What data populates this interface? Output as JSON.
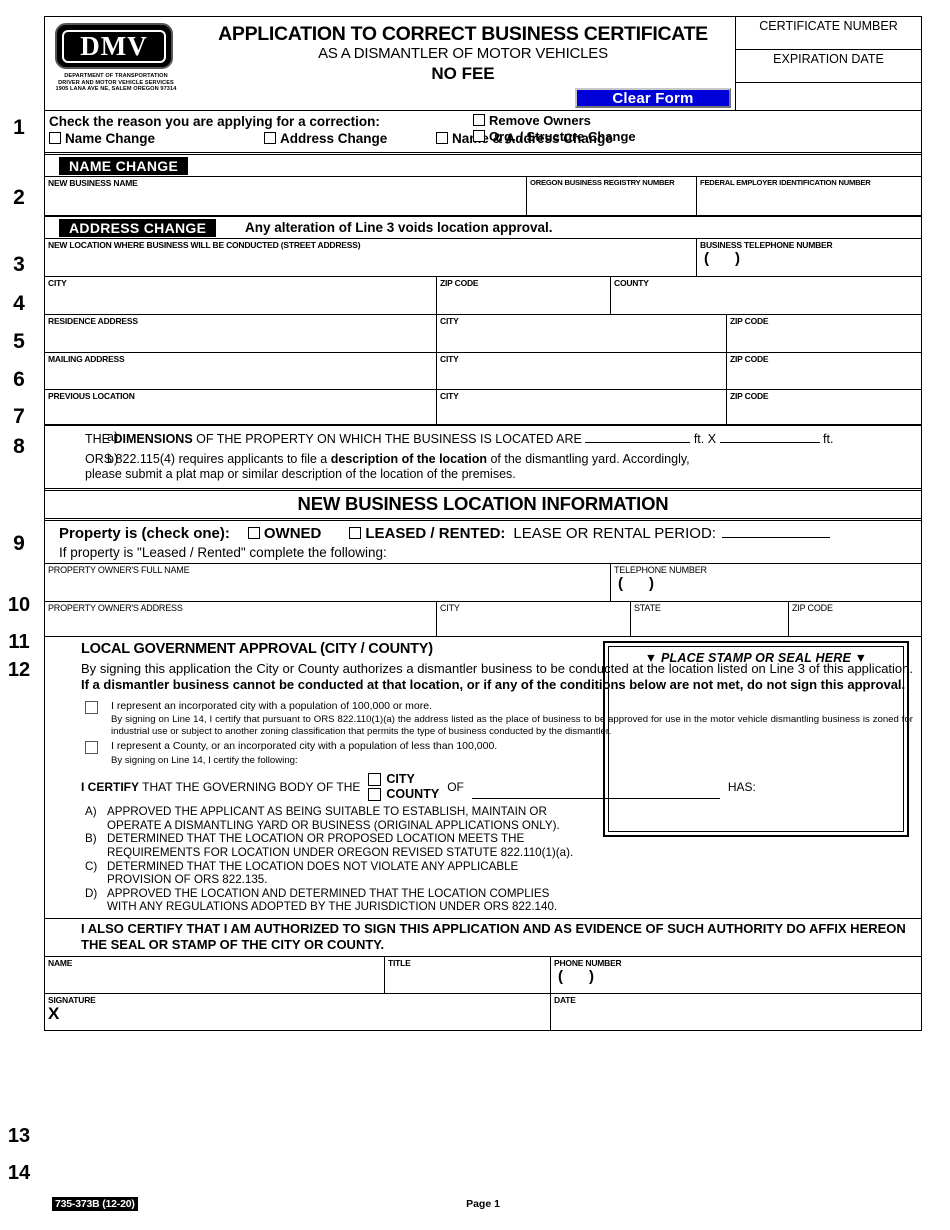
{
  "header": {
    "logo_word": "DMV",
    "agency_lines": [
      "DEPARTMENT OF TRANSPORTATION",
      "DRIVER AND MOTOR VEHICLE SERVICES",
      "1905 LANA AVE NE, SALEM OREGON 97314"
    ],
    "title": "APPLICATION TO CORRECT BUSINESS CERTIFICATE",
    "subtitle": "AS A DISMANTLER OF MOTOR VEHICLES",
    "fee": "NO FEE",
    "clear_form_label": "Clear Form",
    "clear_form_bg": "#0000d8",
    "certificate_number_label": "CERTIFICATE NUMBER",
    "expiration_date_label": "EXPIRATION DATE"
  },
  "section1": {
    "number": "1",
    "heading": "Check the reason you are applying for a correction:",
    "options": [
      {
        "label": "Name Change"
      },
      {
        "label": "Address Change"
      },
      {
        "label": "Name & Address Change"
      }
    ],
    "right_options": [
      {
        "label": "Remove Owners"
      },
      {
        "label": "Org. / Structure Change"
      }
    ]
  },
  "name_change": {
    "tag": "NAME CHANGE",
    "number": "2",
    "fields": [
      {
        "label": "NEW BUSINESS NAME"
      },
      {
        "label": "OREGON BUSINESS REGISTRY NUMBER"
      },
      {
        "label": "FEDERAL EMPLOYER IDENTIFICATION NUMBER"
      }
    ]
  },
  "address_change": {
    "tag": "ADDRESS CHANGE",
    "note": "Any alteration of Line 3 voids location approval.",
    "rows": [
      {
        "number": "3",
        "cells": [
          {
            "label": "NEW LOCATION WHERE BUSINESS WILL BE CONDUCTED    (STREET ADDRESS)"
          },
          {
            "label": "BUSINESS TELEPHONE NUMBER",
            "phone": true
          }
        ]
      },
      {
        "number": "4",
        "cells": [
          {
            "label": "CITY"
          },
          {
            "label": "ZIP CODE"
          },
          {
            "label": "COUNTY"
          }
        ]
      },
      {
        "number": "5",
        "cells": [
          {
            "label": "RESIDENCE ADDRESS"
          },
          {
            "label": "CITY"
          },
          {
            "label": "ZIP CODE"
          }
        ]
      },
      {
        "number": "6",
        "cells": [
          {
            "label": "MAILING ADDRESS"
          },
          {
            "label": "CITY"
          },
          {
            "label": "ZIP CODE"
          }
        ]
      },
      {
        "number": "7",
        "cells": [
          {
            "label": "PREVIOUS LOCATION"
          },
          {
            "label": "CITY"
          },
          {
            "label": "ZIP CODE"
          }
        ]
      }
    ]
  },
  "section8": {
    "number": "8",
    "a_marker": "a)",
    "a_pre": "THE ",
    "a_bold": "DIMENSIONS",
    "a_mid": " OF THE PROPERTY ON WHICH THE BUSINESS IS LOCATED ARE ",
    "a_ft1": "ft. X",
    "a_ft2": "ft.",
    "b_marker": "b)",
    "b_pre": "ORS 822.115(4) requires applicants to file a ",
    "b_bold": "description of the location",
    "b_post": " of the dismantling yard. Accordingly,",
    "b_line2": "please submit a plat map or similar description of the location of the premises."
  },
  "new_location_banner": "NEW BUSINESS LOCATION INFORMATION",
  "section9": {
    "number": "9",
    "prompt": "Property is (check one):",
    "owned_label": "OWNED",
    "leased_label": "LEASED / RENTED:",
    "lease_period_label": "LEASE OR RENTAL PERIOD:",
    "note": "If property is \"Leased / Rented\" complete the following:"
  },
  "owner_rows": [
    {
      "number": "10",
      "cells": [
        {
          "label": "PROPERTY OWNER'S FULL NAME"
        },
        {
          "label": "TELEPHONE NUMBER",
          "phone": true
        }
      ]
    },
    {
      "number": "11",
      "cells": [
        {
          "label": "PROPERTY OWNER'S ADDRESS"
        },
        {
          "label": "CITY"
        },
        {
          "label": "STATE"
        },
        {
          "label": "ZIP CODE"
        }
      ]
    }
  ],
  "section12": {
    "number": "12",
    "heading": "LOCAL GOVERNMENT APPROVAL (CITY / COUNTY)",
    "para_normal1": "By signing this application the City or County authorizes a dismantler business to be conducted at the location listed on Line 3 of this application. ",
    "para_bold": "If a dismantler business cannot be conducted at that location, or if any of the conditions below are not met, do not sign this approval.",
    "checkbox1_label": "I represent an incorporated city with a population of 100,000 or more.",
    "checkbox1_sub": "By signing on Line 14, I certify that pursuant to ORS 822.110(1)(a) the address listed as the place of business to be approved for use in the motor vehicle dismantling business is zoned for industrial use or subject to another zoning classification that permits the type of business conducted by the dismantler.",
    "checkbox2_label": "I represent a County, or an incorporated city with a population of less than 100,000.",
    "checkbox2_sub": "By signing on Line 14, I certify the following:",
    "certify_bold": "I CERTIFY",
    "certify_rest": "THAT THE GOVERNING BODY OF THE",
    "city_label": "CITY",
    "county_label": "COUNTY",
    "of_label": "OF",
    "has_label": "HAS:",
    "items": [
      {
        "marker": "A)",
        "text": "APPROVED THE APPLICANT AS BEING SUITABLE TO ESTABLISH, MAINTAIN OR OPERATE A DISMANTLING YARD OR BUSINESS (ORIGINAL APPLICATIONS ONLY)."
      },
      {
        "marker": "B)",
        "text": "DETERMINED THAT THE LOCATION OR PROPOSED LOCATION MEETS THE REQUIREMENTS FOR LOCATION UNDER OREGON REVISED STATUTE 822.110(1)(a)."
      },
      {
        "marker": "C)",
        "text": "DETERMINED THAT THE LOCATION DOES NOT VIOLATE ANY APPLICABLE PROVISION OF ORS 822.135."
      },
      {
        "marker": "D)",
        "text": "APPROVED THE LOCATION AND DETERMINED THAT THE LOCATION COMPLIES WITH ANY REGULATIONS ADOPTED BY THE JURISDICTION UNDER ORS 822.140."
      }
    ],
    "stamp_label": "▼ PLACE STAMP OR SEAL HERE ▼",
    "also_certify": "I ALSO CERTIFY THAT I AM AUTHORIZED TO SIGN THIS APPLICATION AND AS EVIDENCE OF SUCH AUTHORITY DO AFFIX HEREON THE SEAL OR STAMP OF THE CITY OR COUNTY."
  },
  "signature_rows": [
    {
      "number": "13",
      "cells": [
        {
          "label": "NAME"
        },
        {
          "label": "TITLE"
        },
        {
          "label": "PHONE NUMBER",
          "phone": true
        }
      ]
    },
    {
      "number": "14",
      "cells": [
        {
          "label": "SIGNATURE",
          "x_mark": "X"
        },
        {
          "label": "DATE"
        }
      ]
    }
  ],
  "footer": {
    "form_code": "735-373B (12-20)",
    "page": "Page 1"
  }
}
